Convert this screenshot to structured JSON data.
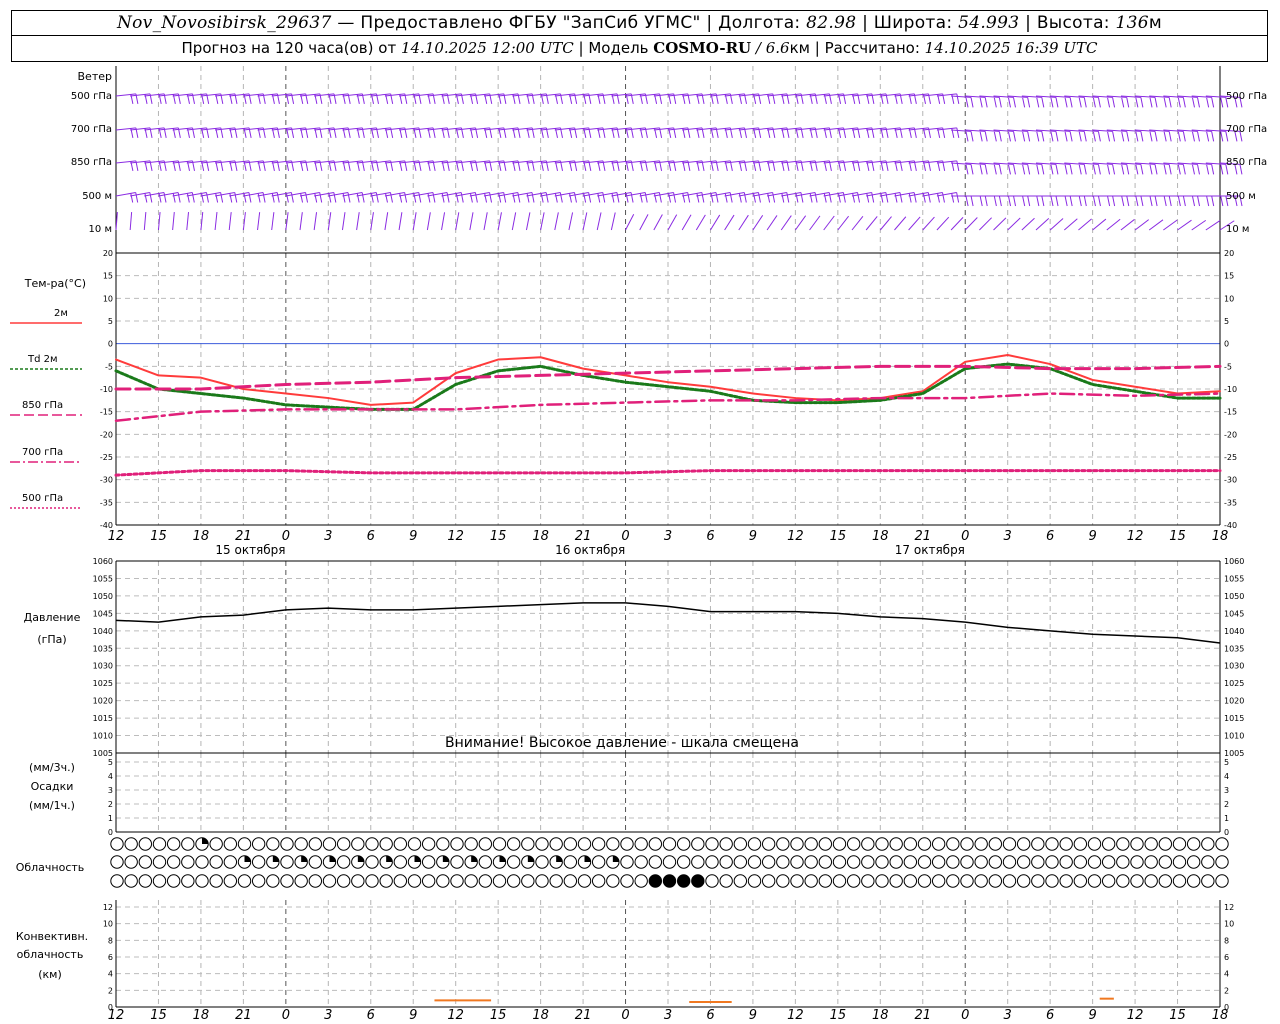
{
  "header": {
    "station": "Nov_Novosibirsk_29637",
    "provider": "— Предоставлено ФГБУ \"ЗапСиб УГМС\" |",
    "lon_label": "Долгота:",
    "lon_value": "82.98",
    "lat_label": "| Широта:",
    "lat_value": "54.993",
    "alt_label": "| Высота:",
    "alt_value": "136",
    "alt_unit": "м",
    "forecast_prefix": "Прогноз на 120 часа(ов) от",
    "forecast_start": "14.10.2025 12:00 UTC",
    "model_label": "| Модель",
    "model_name": "COSMO-RU",
    "model_res": "/ 6.6",
    "model_res_unit": "км |",
    "calc_label": "Рассчитано:",
    "calc_time": "14.10.2025 16:39 UTC"
  },
  "time_axis": {
    "hours": [
      "12",
      "15",
      "18",
      "21",
      "0",
      "3",
      "6",
      "9",
      "12",
      "15",
      "18",
      "21",
      "0",
      "3",
      "6",
      "9",
      "12",
      "15",
      "18",
      "21",
      "0",
      "3",
      "6",
      "9",
      "12",
      "15",
      "18"
    ],
    "day_labels": [
      "15 октября",
      "16 октября",
      "17 октября"
    ],
    "day_label_hours": [
      9,
      33,
      57
    ]
  },
  "wind_panel": {
    "title": "Ветер",
    "levels": [
      "500 гПа",
      "700 гПа",
      "850 гПа",
      "500 м",
      "10  м"
    ],
    "right_levels": [
      "500 гПа",
      "700 гПа",
      "850 гПа",
      "500 м",
      "10 м"
    ],
    "colors": {
      "barb": "#8a2be2"
    }
  },
  "temperature_panel": {
    "title": "Тем-ра(°С)",
    "legend": [
      {
        "label": "2м",
        "color": "#ff3b3b",
        "style": "solid"
      },
      {
        "label": "Td  2м",
        "color": "#1a7a1a",
        "style": "dotted"
      },
      {
        "label": "850 гПа",
        "color": "#e0207a",
        "style": "dashed"
      },
      {
        "label": "700 гПа",
        "color": "#e0207a",
        "style": "dashdot"
      },
      {
        "label": "500 гПа",
        "color": "#e0207a",
        "style": "dots"
      }
    ],
    "yticks": [
      "20",
      "15",
      "10",
      "5",
      "0",
      "-5",
      "-10",
      "-15",
      "-20",
      "-25",
      "-30",
      "-35",
      "-40"
    ]
  },
  "pressure_panel": {
    "title_line1": "Давление",
    "title_line2": "(гПа)",
    "yticks": [
      "1060",
      "1055",
      "1050",
      "1045",
      "1040",
      "1035",
      "1030",
      "1025",
      "1020",
      "1015",
      "1010",
      "1005"
    ],
    "warning": "Внимание! Высокое давление - шкала смещена"
  },
  "precip_panel": {
    "line1": "(мм/3ч.)",
    "line2": "Осадки",
    "line3": "(мм/1ч.)",
    "yticks": [
      "5",
      "4",
      "3",
      "2",
      "1",
      "0"
    ]
  },
  "cloud_panel": {
    "title": "Облачность"
  },
  "convective_panel": {
    "line1": "Конвективн.",
    "line2": "облачность",
    "line3": "(км)",
    "yticks": [
      "12",
      "10",
      "8",
      "6",
      "4",
      "2",
      "0"
    ]
  },
  "chart_data": [
    {
      "type": "line",
      "title": "Тем-ра(°С)",
      "x_hours_from_start": [
        0,
        3,
        6,
        9,
        12,
        15,
        18,
        21,
        24,
        27,
        30,
        33,
        36,
        39,
        42,
        45,
        48,
        51,
        54,
        57,
        60,
        63,
        66,
        69,
        72,
        75,
        78,
        81,
        84,
        87,
        90,
        93,
        96,
        99,
        102,
        105,
        108,
        111,
        114,
        117,
        120,
        123,
        126,
        129,
        132,
        135,
        138,
        141,
        144,
        147,
        150,
        153,
        156,
        159,
        162,
        165,
        168,
        171,
        174,
        177,
        180,
        183,
        186,
        189,
        192,
        195,
        198,
        201,
        204,
        207,
        210,
        213,
        216,
        219,
        222,
        225,
        228,
        231,
        234
      ],
      "ylim": [
        -40,
        20
      ],
      "series": [
        {
          "name": "2м",
          "color": "#ff3b3b",
          "x": [
            0,
            3,
            6,
            9,
            12,
            15,
            18,
            21,
            24,
            27,
            30,
            33,
            36,
            39,
            42,
            45,
            48,
            51,
            54,
            57,
            60,
            63,
            66,
            69,
            72,
            75,
            78
          ],
          "values": [
            -3.5,
            -7,
            -7.5,
            -10,
            -11,
            -12,
            -13.5,
            -13,
            -6.5,
            -3.5,
            -3,
            -5.5,
            -7,
            -8.5,
            -9.5,
            -11,
            -12,
            -12.5,
            -12,
            -10.5,
            -4,
            -2.5,
            -4.5,
            -8,
            -9.5,
            -11,
            -10.5
          ]
        },
        {
          "name": "Td  2м",
          "color": "#1a7a1a",
          "x": [
            0,
            3,
            6,
            9,
            12,
            15,
            18,
            21,
            24,
            27,
            30,
            33,
            36,
            39,
            42,
            45,
            48,
            51,
            54,
            57,
            60,
            63,
            66,
            69,
            72,
            75,
            78
          ],
          "values": [
            -6,
            -10,
            -11,
            -12,
            -13.5,
            -14,
            -14.5,
            -14.5,
            -9,
            -6,
            -5,
            -7,
            -8.5,
            -9.5,
            -10.5,
            -12.5,
            -13,
            -13,
            -12.5,
            -11,
            -5.5,
            -4.5,
            -5.5,
            -9,
            -10.5,
            -12,
            -12
          ]
        },
        {
          "name": "850 гПа",
          "color": "#e0207a",
          "x": [
            0,
            6,
            12,
            18,
            24,
            30,
            36,
            42,
            48,
            54,
            60,
            66,
            72,
            78
          ],
          "values": [
            -10,
            -10,
            -9,
            -8.5,
            -7.5,
            -7,
            -6.5,
            -6,
            -5.5,
            -5,
            -5,
            -5.5,
            -5.5,
            -5
          ]
        },
        {
          "name": "700 гПа",
          "color": "#e0207a",
          "x": [
            0,
            6,
            12,
            18,
            24,
            30,
            36,
            42,
            48,
            54,
            60,
            66,
            72,
            78
          ],
          "values": [
            -17,
            -15,
            -14.5,
            -14.5,
            -14.5,
            -13.5,
            -13,
            -12.5,
            -12.5,
            -12,
            -12,
            -11,
            -11.5,
            -11
          ]
        },
        {
          "name": "500 гПа",
          "color": "#e0207a",
          "x": [
            0,
            6,
            12,
            18,
            24,
            30,
            36,
            42,
            48,
            54,
            60,
            66,
            72,
            78
          ],
          "values": [
            -29,
            -28,
            -28,
            -28.5,
            -28.5,
            -28.5,
            -28.5,
            -28,
            -28,
            -28,
            -28,
            -28,
            -28,
            -28
          ]
        }
      ]
    },
    {
      "type": "line",
      "title": "Давление",
      "ylim": [
        1005,
        1060
      ],
      "series": [
        {
          "name": "Давление",
          "color": "#000000",
          "x": [
            0,
            3,
            6,
            9,
            12,
            15,
            18,
            21,
            24,
            27,
            30,
            33,
            36,
            39,
            42,
            45,
            48,
            51,
            54,
            57,
            60,
            63,
            66,
            69,
            72,
            75,
            78
          ],
          "values": [
            1043,
            1042.5,
            1044,
            1044.5,
            1046,
            1046.5,
            1046,
            1046,
            1046.5,
            1047,
            1047.5,
            1048,
            1048,
            1047,
            1045.5,
            1045.5,
            1045.5,
            1045,
            1044,
            1043.5,
            1042.5,
            1041,
            1040,
            1039,
            1038.5,
            1038,
            1036.5
          ]
        }
      ]
    }
  ]
}
